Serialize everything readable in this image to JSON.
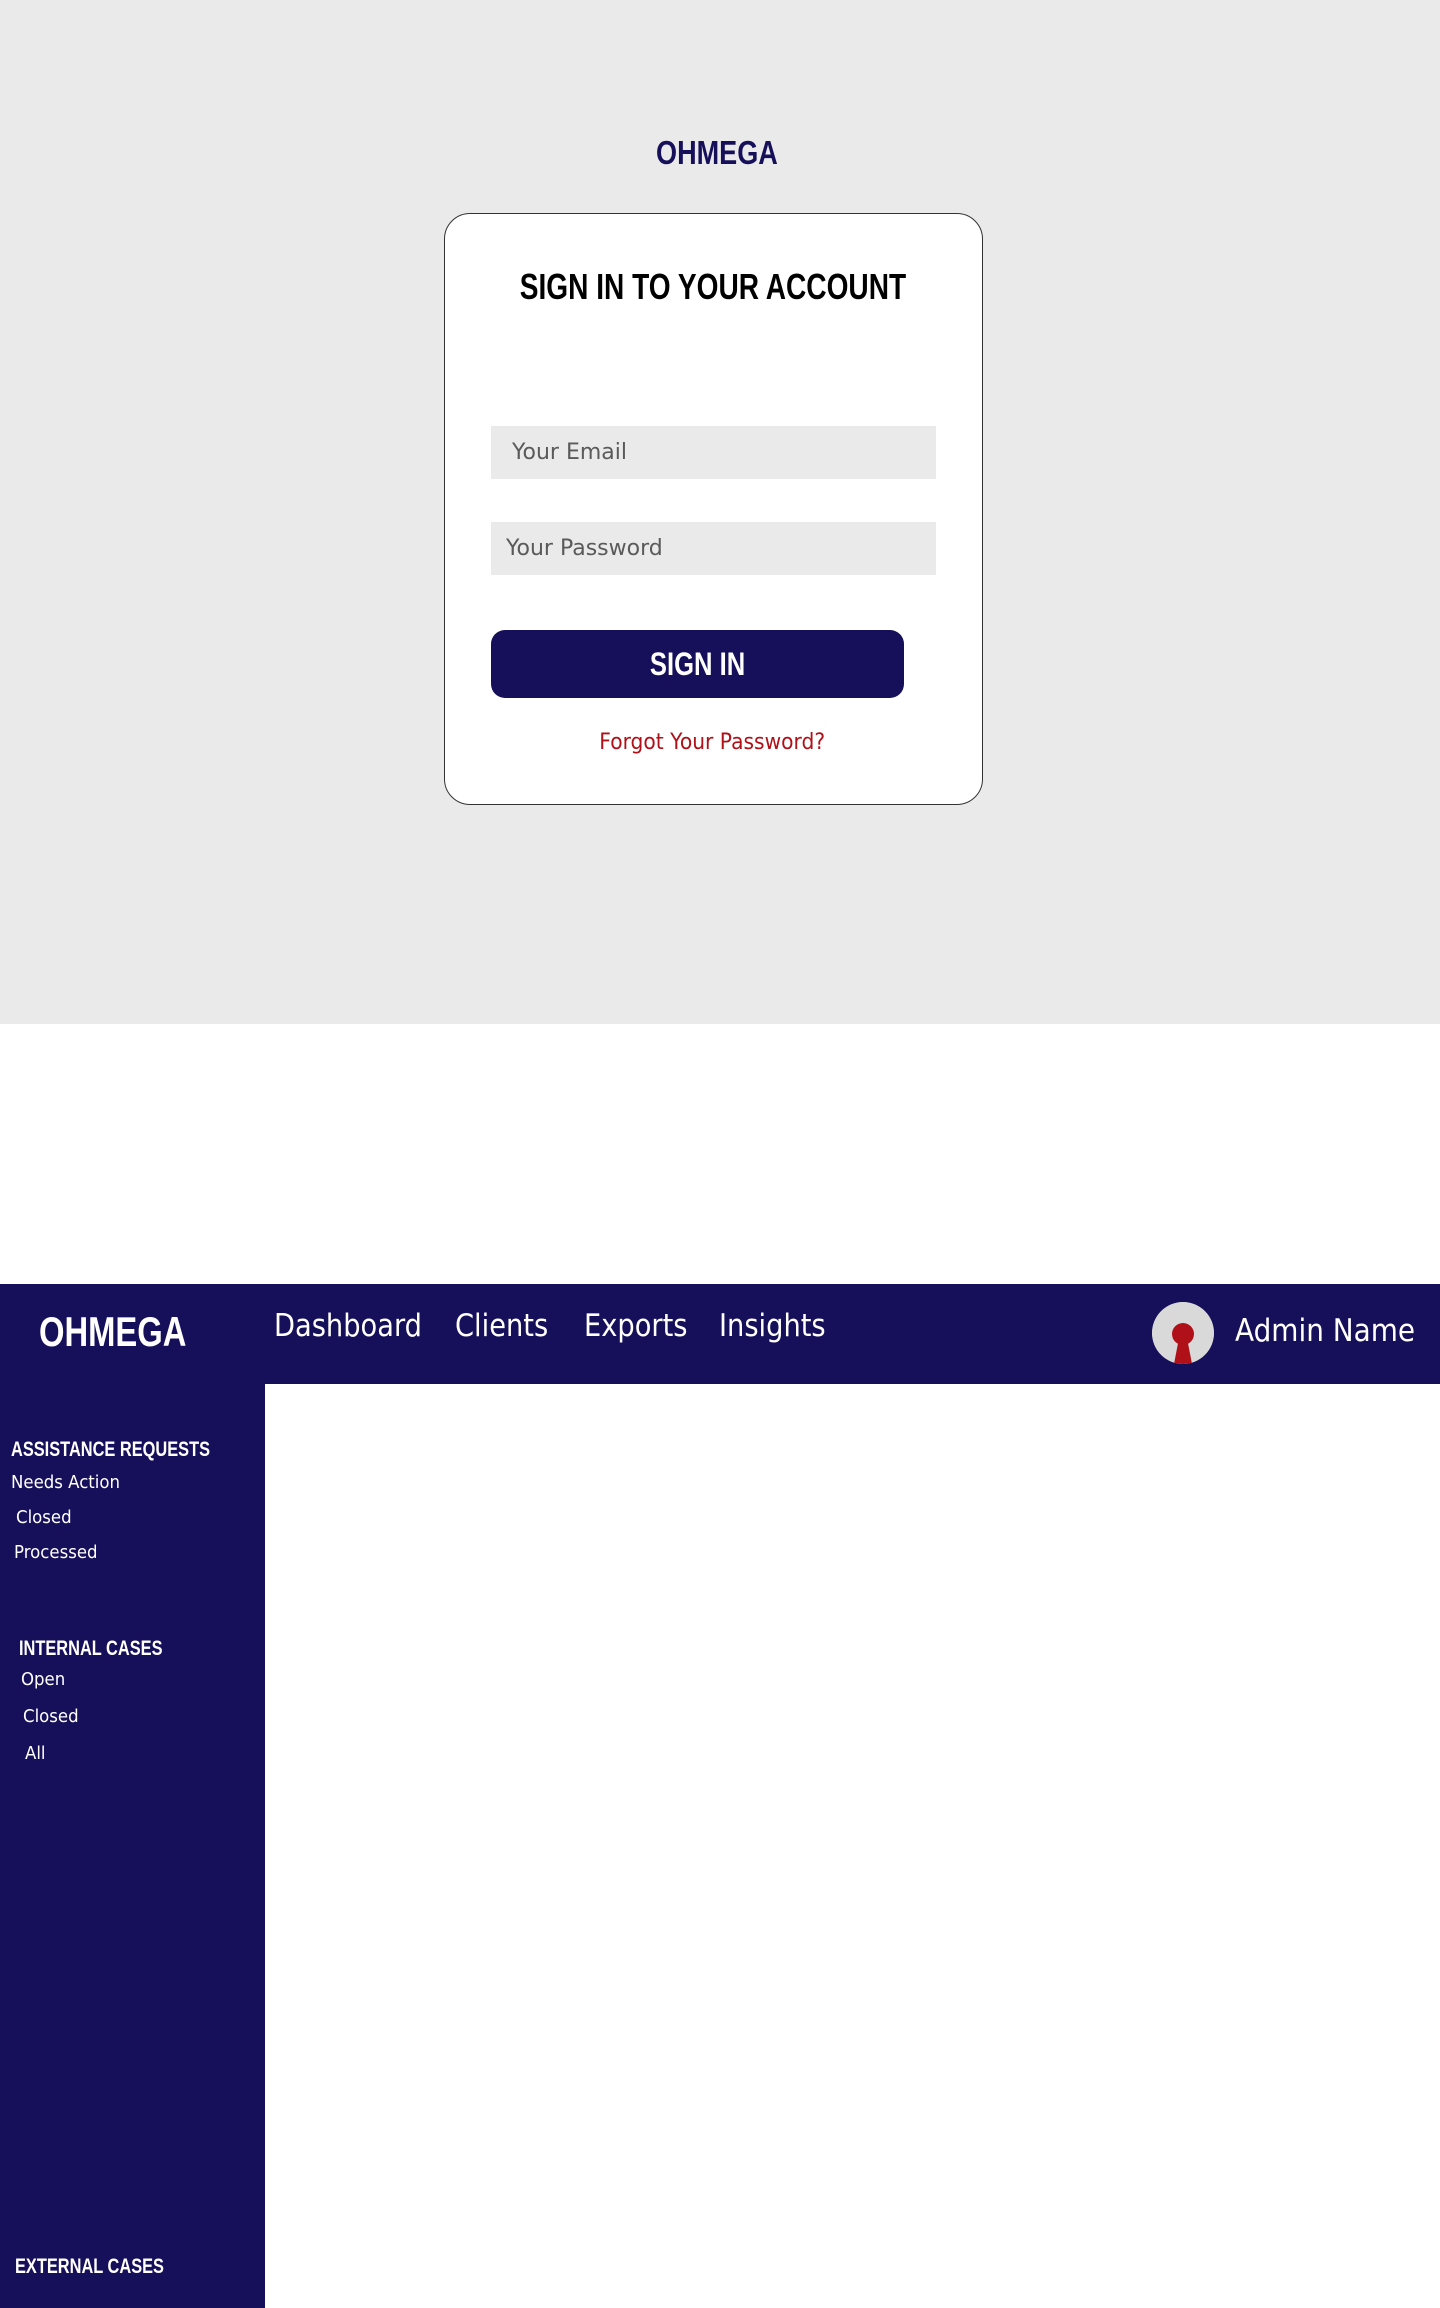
{
  "login": {
    "logo": "OHMEGA",
    "title": "SIGN IN TO YOUR ACCOUNT",
    "email_placeholder": "Your Email",
    "password_placeholder": "Your Password",
    "signin_label": "SIGN IN",
    "forgot_label": "Forgot Your Password?"
  },
  "dashboard": {
    "brand": "OHMEGA",
    "nav": [
      "Dashboard",
      "Clients",
      "Exports",
      "Insights"
    ],
    "user_name": "Admin Name",
    "sidebar": {
      "assistance_requests": {
        "heading": "ASSISTANCE REQUESTS",
        "items": [
          "Needs Action",
          "Closed",
          "Processed"
        ]
      },
      "internal_cases": {
        "heading": "INTERNAL CASES",
        "items": [
          "Open",
          "Closed",
          "All"
        ]
      },
      "external_cases": {
        "heading": "EXTERNAL CASES"
      }
    }
  },
  "colors": {
    "navy": "#16105a",
    "login_bg": "#eaeaea",
    "link_red": "#b01018",
    "avatar_red": "#b01018"
  },
  "icons": {
    "avatar": "user-avatar-icon"
  }
}
